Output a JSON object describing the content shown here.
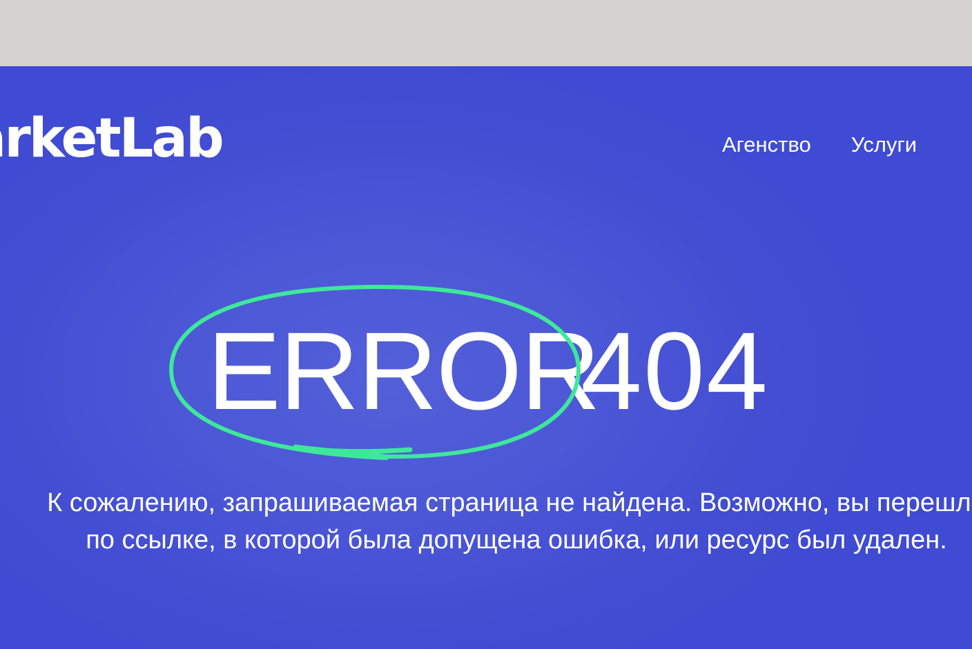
{
  "header": {
    "logo_text": "MarketLab",
    "nav": [
      {
        "label": "Агенство"
      },
      {
        "label": "Услуги"
      }
    ]
  },
  "error": {
    "word": "ERROR",
    "code": "404",
    "highlight_color": "#3ee89a"
  },
  "message": {
    "line1": "К сожалению, запрашиваемая страница не найдена. Возможно, вы перешли",
    "line2": "по ссылке, в которой была допущена ошибка, или ресурс был удален."
  },
  "colors": {
    "browser_bar": "#d7d2d2",
    "background": "#434ed3",
    "text": "#ffffff",
    "accent": "#3ee89a"
  }
}
